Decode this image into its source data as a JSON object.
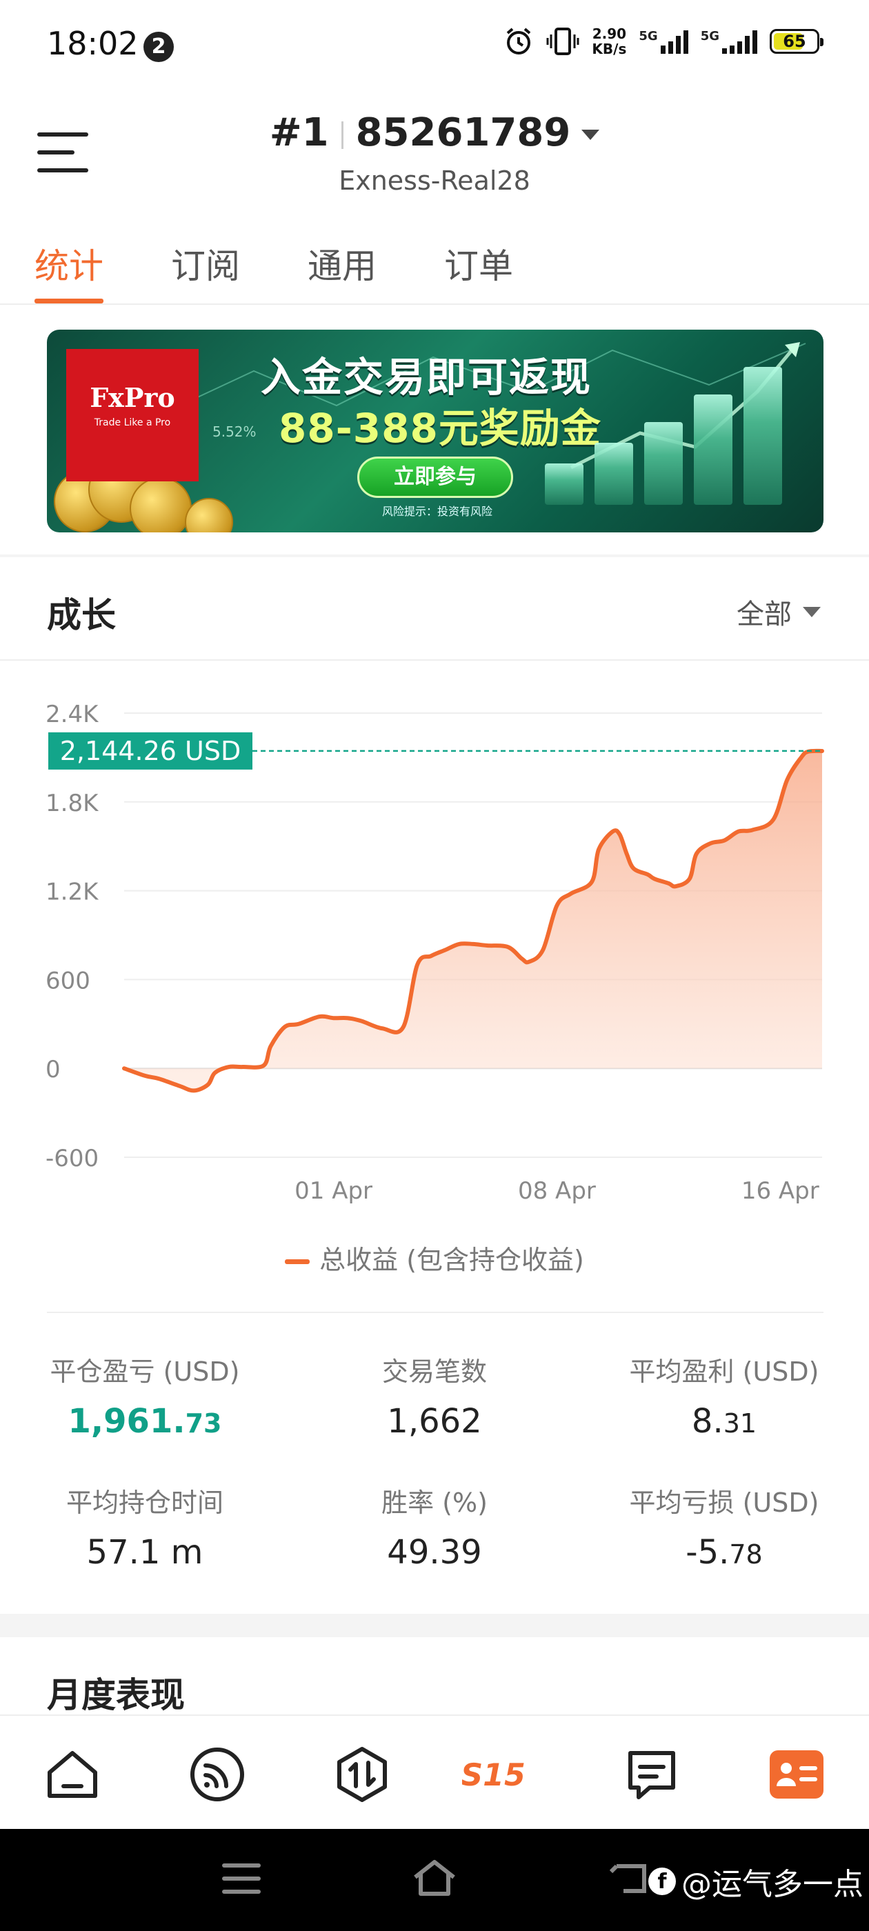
{
  "status_bar": {
    "time": "18:02",
    "notification_count": "2",
    "net_speed_value": "2.90",
    "net_speed_unit": "KB/s",
    "sim1_label": "5G",
    "sim2_label": "5G",
    "battery": "65"
  },
  "header": {
    "rank": "#1",
    "account_number": "85261789",
    "server": "Exness-Real28"
  },
  "tabs": [
    {
      "label": "统计",
      "active": true
    },
    {
      "label": "订阅",
      "active": false
    },
    {
      "label": "通用",
      "active": false
    },
    {
      "label": "订单",
      "active": false
    }
  ],
  "banner": {
    "brand": "FxPro",
    "brand_tagline": "Trade Like a Pro",
    "headline": "入金交易即可返现",
    "subheadline": "88-388元奖励金",
    "cta": "立即参与",
    "risk_note": "风险提示：投资有风险",
    "side_value": "5.52%"
  },
  "growth": {
    "title": "成长",
    "range_selector": "全部"
  },
  "chart_data": {
    "type": "area",
    "current_value_label": "2,144.26 USD",
    "current_value": 2144.26,
    "y_tick_labels": [
      "2.4K",
      "1.8K",
      "1.2K",
      "600",
      "0",
      "-600"
    ],
    "y_ticks": [
      2400,
      1800,
      1200,
      600,
      0,
      -600
    ],
    "ylim": [
      -600,
      2400
    ],
    "x_tick_labels": [
      "01 Apr",
      "08 Apr",
      "16 Apr"
    ],
    "x_tick_positions": [
      0.3,
      0.62,
      0.94
    ],
    "xlim": [
      0,
      1
    ],
    "grid": true,
    "legend": "bottom",
    "series": [
      {
        "name": "总收益 (包含持仓收益)",
        "color": "#f26b2f",
        "x": [
          0.0,
          0.03,
          0.05,
          0.08,
          0.1,
          0.12,
          0.13,
          0.15,
          0.17,
          0.2,
          0.21,
          0.23,
          0.25,
          0.28,
          0.3,
          0.32,
          0.34,
          0.37,
          0.4,
          0.42,
          0.44,
          0.46,
          0.48,
          0.5,
          0.52,
          0.55,
          0.57,
          0.58,
          0.6,
          0.62,
          0.64,
          0.67,
          0.68,
          0.7,
          0.71,
          0.72,
          0.73,
          0.75,
          0.76,
          0.78,
          0.79,
          0.81,
          0.82,
          0.84,
          0.86,
          0.88,
          0.9,
          0.93,
          0.95,
          0.97,
          0.98,
          1.0
        ],
        "y": [
          0,
          -50,
          -70,
          -120,
          -150,
          -110,
          -30,
          10,
          10,
          20,
          150,
          280,
          300,
          350,
          340,
          340,
          320,
          270,
          280,
          700,
          760,
          800,
          840,
          840,
          830,
          820,
          740,
          720,
          800,
          1100,
          1180,
          1260,
          1480,
          1600,
          1580,
          1450,
          1350,
          1310,
          1280,
          1250,
          1230,
          1280,
          1450,
          1520,
          1540,
          1600,
          1610,
          1680,
          1950,
          2100,
          2140,
          2144
        ]
      }
    ]
  },
  "stats": [
    {
      "label": "平仓盈亏 (USD)",
      "value_main": "1,961.",
      "value_dec": "73",
      "color": "green"
    },
    {
      "label": "交易笔数",
      "value_main": "1,662",
      "value_dec": ""
    },
    {
      "label": "平均盈利 (USD)",
      "value_main": "8.",
      "value_dec": "31"
    },
    {
      "label": "平均持仓时间",
      "value_main": "57.1 m",
      "value_dec": ""
    },
    {
      "label": "胜率 (%)",
      "value_main": "49.39",
      "value_dec": ""
    },
    {
      "label": "平均亏损 (USD)",
      "value_main": "-5.",
      "value_dec": "78"
    }
  ],
  "monthly": {
    "title": "月度表现"
  },
  "bottom_nav": [
    {
      "icon": "home-icon"
    },
    {
      "icon": "feed-icon"
    },
    {
      "icon": "trade-icon"
    },
    {
      "icon": "s15-logo-icon",
      "label": "S15"
    },
    {
      "icon": "chat-icon"
    },
    {
      "icon": "profile-card-icon",
      "active": true
    }
  ],
  "watermark": {
    "text": "@运气多一点",
    "fb_letter": "f"
  },
  "colors": {
    "accent": "#f26b2f",
    "profit_green": "#10a088",
    "value_tag": "#13a58a"
  }
}
